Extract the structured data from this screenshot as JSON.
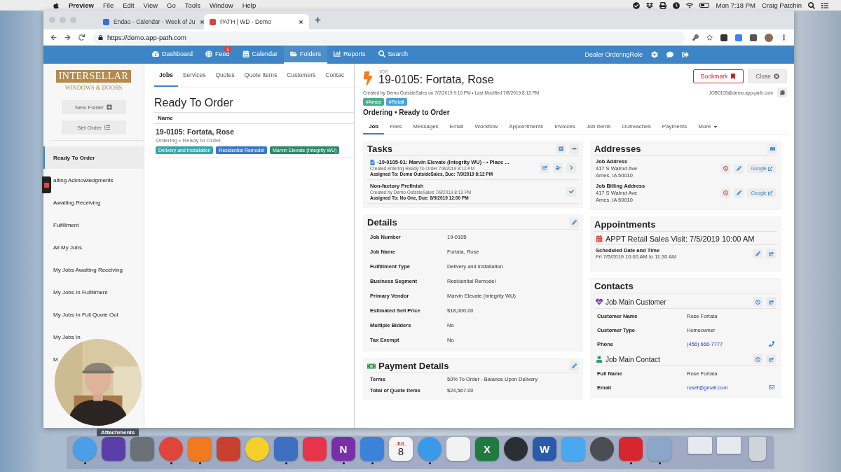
{
  "menubar": {
    "app": "Preview",
    "menus": [
      "File",
      "Edit",
      "View",
      "Go",
      "Tools",
      "Window",
      "Help"
    ],
    "clock": "Mon 7:18 PM",
    "user": "Craig Patchin"
  },
  "browser": {
    "tabs": [
      {
        "title": "Endao - Calendar - Week of Ju",
        "selected": false
      },
      {
        "title": "PATH | WD - Demo",
        "selected": true
      }
    ],
    "url": "https://demo.app-path.com"
  },
  "navbar": {
    "items": [
      {
        "label": "Dashboard",
        "selected": false
      },
      {
        "label": "Feed",
        "badge": "1",
        "selected": false
      },
      {
        "label": "Calendar",
        "selected": false
      },
      {
        "label": "Folders",
        "selected": true
      },
      {
        "label": "Reports",
        "selected": false
      },
      {
        "label": "Search",
        "selected": false
      }
    ],
    "role": "Dealer OrderingRole"
  },
  "sidebar": {
    "logo": {
      "name": "INTERSELLAR",
      "tagline": "WINDOWS & DOORS"
    },
    "buttons": [
      "New Folder",
      "Set Order"
    ],
    "folders": [
      {
        "label": "Ready To Order",
        "selected": true
      },
      {
        "label": "aiting Acknowledgments",
        "selected": false
      },
      {
        "label": "Awaiting Receiving",
        "selected": false
      },
      {
        "label": "Fulfillment",
        "selected": false
      },
      {
        "label": "All My Jobs",
        "selected": false
      },
      {
        "label": "My Jobs Awaiting Receiving",
        "selected": false
      },
      {
        "label": "My Jobs In Fulfillment",
        "selected": false
      },
      {
        "label": "My Jobs In Full Quote Out",
        "selected": false
      },
      {
        "label": "My Jobs In",
        "selected": false
      },
      {
        "label": "M",
        "selected": false
      }
    ]
  },
  "list_panel": {
    "tabs": [
      {
        "label": "Jobs",
        "selected": true
      },
      {
        "label": "Services",
        "selected": false
      },
      {
        "label": "Quotes",
        "selected": false
      },
      {
        "label": "Quote Items",
        "selected": false
      },
      {
        "label": "Customers",
        "selected": false
      },
      {
        "label": "Contac",
        "selected": false
      }
    ],
    "title": "Ready To Order",
    "column": "Name",
    "rows": [
      {
        "title": "19-0105: Fortata, Rose",
        "subtitle": "Ordering • Ready to Order",
        "tags": [
          {
            "label": "Delivery and Installation",
            "color": "#3aa6a8"
          },
          {
            "label": "Residential Remodel",
            "color": "#3b78c9"
          },
          {
            "label": "Marvin Elevate (Integrity WU)",
            "color": "#2e8a6a"
          }
        ]
      }
    ]
  },
  "job": {
    "kind_label": "JOB",
    "title": "19-0105: Fortata, Rose",
    "meta": "Created by Demo OutsideSales on 7/2/2019 9:10 PM • Last Modified 7/8/2019 8:12 PM",
    "buttons": [
      {
        "label": "Bookmark",
        "kind": "bookmark"
      },
      {
        "label": "Close",
        "kind": "close"
      }
    ],
    "email": "JOB0105@demo.app-path.com",
    "tags": [
      {
        "label": "#Ames",
        "color": "#4caf8a"
      },
      {
        "label": "#Retail",
        "color": "#4aa3df"
      }
    ],
    "status": "Ordering • Ready to Order",
    "tabs": [
      {
        "label": "Job",
        "selected": true
      },
      {
        "label": "Files",
        "selected": false
      },
      {
        "label": "Messages",
        "selected": false
      },
      {
        "label": "Email",
        "selected": false
      },
      {
        "label": "Workflow",
        "selected": false
      },
      {
        "label": "Appointments",
        "selected": false
      },
      {
        "label": "Invoices",
        "selected": false
      },
      {
        "label": "Job Items",
        "selected": false
      },
      {
        "label": "Outreaches",
        "selected": false
      },
      {
        "label": "Payments",
        "selected": false
      }
    ],
    "more": "More",
    "tasks": {
      "title": "Tasks",
      "items": [
        {
          "kind": "open",
          "title": "-19-0105-01: Marvin Elevate (Integrity WU) - • Place ...",
          "created": "Created entering Ready To Order 7/8/2019 8:12 PM",
          "assigned": "Assigned To: Demo OutsideSales, Due: 7/9/2019 8:12 PM"
        },
        {
          "kind": "done",
          "title": "Non-factory Prefinish",
          "created": "Created by Demo OutsideSales 7/8/2019 8:13 PM",
          "assigned": "Assigned To: No One, Due: 8/9/2019 12:00 PM"
        }
      ]
    },
    "addresses": {
      "title": "Addresses",
      "items": [
        {
          "label": "Job Address",
          "line1": "417 S Walnut Ave",
          "line2": "Ames, IA 50010",
          "link": "Google"
        },
        {
          "label": "Job Billing Address",
          "line1": "417 S Walnut Ave",
          "line2": "Ames, IA 50010",
          "link": "Google"
        }
      ]
    },
    "details": {
      "title": "Details",
      "rows": [
        {
          "label": "Job Number",
          "value": "19-0105"
        },
        {
          "label": "Job Name",
          "value": "Fortata, Rose"
        },
        {
          "label": "Fulfillment Type",
          "value": "Delivery and Installation"
        },
        {
          "label": "Business Segment",
          "value": "Residential Remodel"
        },
        {
          "label": "Primary Vendor",
          "value": "Marvin Elevate (Integrity WU)"
        },
        {
          "label": "Estimated Sell Price",
          "value": "$18,000.00"
        },
        {
          "label": "Multiple Bidders",
          "value": "No"
        },
        {
          "label": "Tax Exempt",
          "value": "No"
        }
      ]
    },
    "payment": {
      "title": "Payment Details",
      "rows": [
        {
          "label": "Terms",
          "value": "50% To Order - Balance Upon Delivery"
        },
        {
          "label": "Total of Quote Items",
          "value": "$24,567.00"
        }
      ]
    },
    "appointments": {
      "title": "Appointments",
      "items": [
        {
          "title": "APPT Retail Sales Visit: 7/5/2019 10:00 AM",
          "label": "Scheduled Date and Time",
          "when": "Fri 7/5/2019 10:00 AM to 11:30 AM"
        }
      ]
    },
    "contacts": {
      "title": "Contacts",
      "groups": [
        {
          "kind": "customer",
          "title": "Job Main Customer",
          "rows": [
            {
              "label": "Customer Name",
              "value": "Rose Fortata",
              "kind": "text"
            },
            {
              "label": "Customer Type",
              "value": "Homeowner",
              "kind": "text"
            },
            {
              "label": "Phone",
              "value": "(456) 666-7777",
              "kind": "phone"
            }
          ]
        },
        {
          "kind": "contact",
          "title": "Job Main Contact",
          "rows": [
            {
              "label": "Full Name",
              "value": "Rose Fortata",
              "kind": "text"
            },
            {
              "label": "Email",
              "value": "rosef@gmail.com",
              "kind": "email"
            }
          ]
        }
      ]
    }
  },
  "overlay": {
    "caption": "Attachments"
  },
  "dock": [
    {
      "kind": "app",
      "color": "#4a9fe8",
      "running": true
    },
    {
      "kind": "app",
      "color": "#5b3fa8",
      "running": false
    },
    {
      "kind": "app",
      "color": "#6b7077",
      "running": false
    },
    {
      "kind": "app",
      "color": "#e0453a",
      "running": true
    },
    {
      "kind": "app",
      "color": "#f07a1f",
      "running": true
    },
    {
      "kind": "app",
      "color": "#c9402f",
      "running": false
    },
    {
      "kind": "app",
      "color": "#f5d02a",
      "running": false
    },
    {
      "kind": "app",
      "color": "#3f6fbf",
      "running": true
    },
    {
      "kind": "app",
      "color": "#e8344a",
      "running": false
    },
    {
      "kind": "app",
      "color": "#7a2fa8",
      "letter": "N",
      "running": true
    },
    {
      "kind": "app",
      "color": "#3b82d8",
      "running": true
    },
    {
      "kind": "calendar",
      "color": "#f4f4f4",
      "month": "JUL",
      "day": "8",
      "running": false
    },
    {
      "kind": "app",
      "color": "#3b9ae8",
      "running": true
    },
    {
      "kind": "app",
      "color": "#f2f2f2",
      "running": false
    },
    {
      "kind": "app",
      "color": "#1f7a3f",
      "letter": "X",
      "running": false
    },
    {
      "kind": "app",
      "color": "#2a2f36",
      "running": false
    },
    {
      "kind": "app",
      "color": "#2b5aa8",
      "letter": "W",
      "running": false
    },
    {
      "kind": "app",
      "color": "#4aa8f0",
      "running": false
    },
    {
      "kind": "app",
      "color": "#4a4d52",
      "running": false
    },
    {
      "kind": "app",
      "color": "#d8262e",
      "running": true
    },
    {
      "kind": "app",
      "color": "#8aa6c8",
      "running": true
    },
    {
      "kind": "window",
      "color": "#e6eaee",
      "running": false
    },
    {
      "kind": "window",
      "color": "#e6eaee",
      "running": false
    },
    {
      "kind": "trash",
      "color": "#cfd4d8",
      "running": false
    }
  ]
}
